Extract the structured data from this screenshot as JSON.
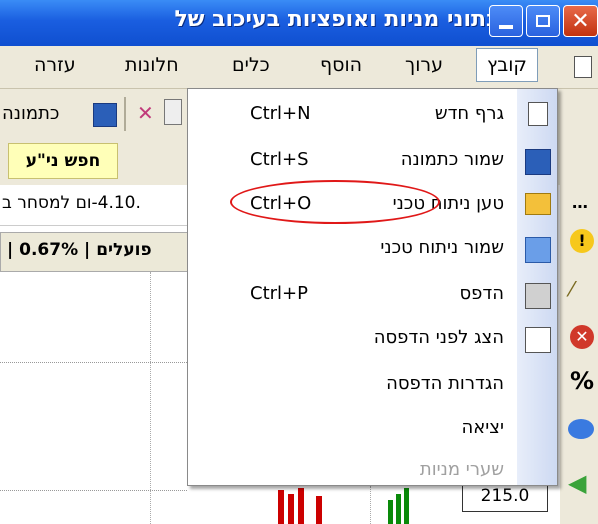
{
  "window": {
    "title": "נתוני מניות ואופציות בעיכוב של",
    "buttons": [
      "minimize",
      "restore",
      "close"
    ]
  },
  "menubar": {
    "items": [
      {
        "label": "קובץ",
        "active": true
      },
      {
        "label": "ערוך",
        "active": false
      },
      {
        "label": "הוסף",
        "active": false
      },
      {
        "label": "כלים",
        "active": false
      },
      {
        "label": "חלונות",
        "active": false
      },
      {
        "label": "עזרה",
        "active": false
      }
    ]
  },
  "toolbar": {
    "save_image_label": "כתמונה"
  },
  "search": {
    "button_label": "חפש ני\"ע"
  },
  "info": {
    "trade_text": ".4.10-ום למסחר ב",
    "percent": "0.67%",
    "bank_label": "פועלים"
  },
  "chart": {
    "price_label": "215.0"
  },
  "file_menu": {
    "items": [
      {
        "label": "גרף חדש",
        "shortcut": "Ctrl+N",
        "icon": "new-document-icon",
        "enabled": true
      },
      {
        "label": "שמור כתמונה",
        "shortcut": "Ctrl+S",
        "icon": "save-disk-icon",
        "enabled": true
      },
      {
        "label": "טען ניתוח טכני",
        "shortcut": "Ctrl+O",
        "icon": "open-folder-icon",
        "enabled": true,
        "highlighted": true
      },
      {
        "label": "שמור ניתוח טכני",
        "shortcut": "",
        "icon": "save-analysis-icon",
        "enabled": true
      },
      {
        "label": "הדפס",
        "shortcut": "Ctrl+P",
        "icon": "printer-icon",
        "enabled": true
      },
      {
        "label": "הצג לפני הדפסה",
        "shortcut": "",
        "icon": "print-preview-icon",
        "enabled": true
      },
      {
        "label": "הגדרות הדפסה",
        "shortcut": "",
        "icon": "",
        "enabled": true
      },
      {
        "label": "יציאה",
        "shortcut": "",
        "icon": "",
        "enabled": true
      },
      {
        "label": "שערי מניות",
        "shortcut": "",
        "icon": "",
        "enabled": false
      }
    ]
  },
  "colors": {
    "titlebar": "#1a5ee0",
    "menubar": "#ede9da",
    "highlight_ellipse": "#e01818",
    "search_button": "#ffffb8"
  }
}
